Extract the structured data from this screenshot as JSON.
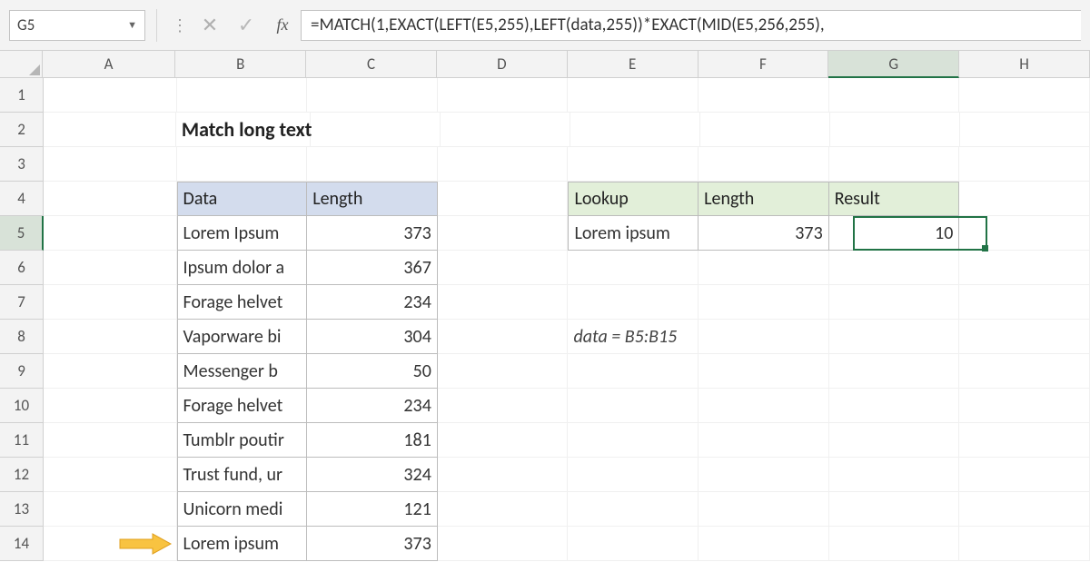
{
  "namebox": "G5",
  "formula": "=MATCH(1,EXACT(LEFT(E5,255),LEFT(data,255))*EXACT(MID(E5,256,255),",
  "columns": [
    "A",
    "B",
    "C",
    "D",
    "E",
    "F",
    "G",
    "H"
  ],
  "rows": [
    "1",
    "2",
    "3",
    "4",
    "5",
    "6",
    "7",
    "8",
    "9",
    "10",
    "11",
    "12",
    "13",
    "14"
  ],
  "title": "Match long text",
  "table1": {
    "headers": [
      "Data",
      "Length"
    ],
    "rows": [
      {
        "data": "Lorem Ipsum",
        "len": "373"
      },
      {
        "data": "Ipsum dolor a",
        "len": "367"
      },
      {
        "data": "Forage helvet",
        "len": "234"
      },
      {
        "data": "Vaporware bi",
        "len": "304"
      },
      {
        "data": "Messenger b",
        "len": "50"
      },
      {
        "data": "Forage helvet",
        "len": "234"
      },
      {
        "data": "Tumblr poutir",
        "len": "181"
      },
      {
        "data": "Trust fund, ur",
        "len": "324"
      },
      {
        "data": "Unicorn medi",
        "len": "121"
      },
      {
        "data": "Lorem ipsum",
        "len": "373"
      }
    ]
  },
  "table2": {
    "headers": [
      "Lookup",
      "Length",
      "Result"
    ],
    "row": {
      "lookup": "Lorem ipsum",
      "len": "373",
      "result": "10"
    }
  },
  "note": "data = B5:B15",
  "icons": {
    "dropdown": "▼",
    "vdots": "⋮",
    "cancel": "✕",
    "check": "✓",
    "fx": "fx"
  }
}
